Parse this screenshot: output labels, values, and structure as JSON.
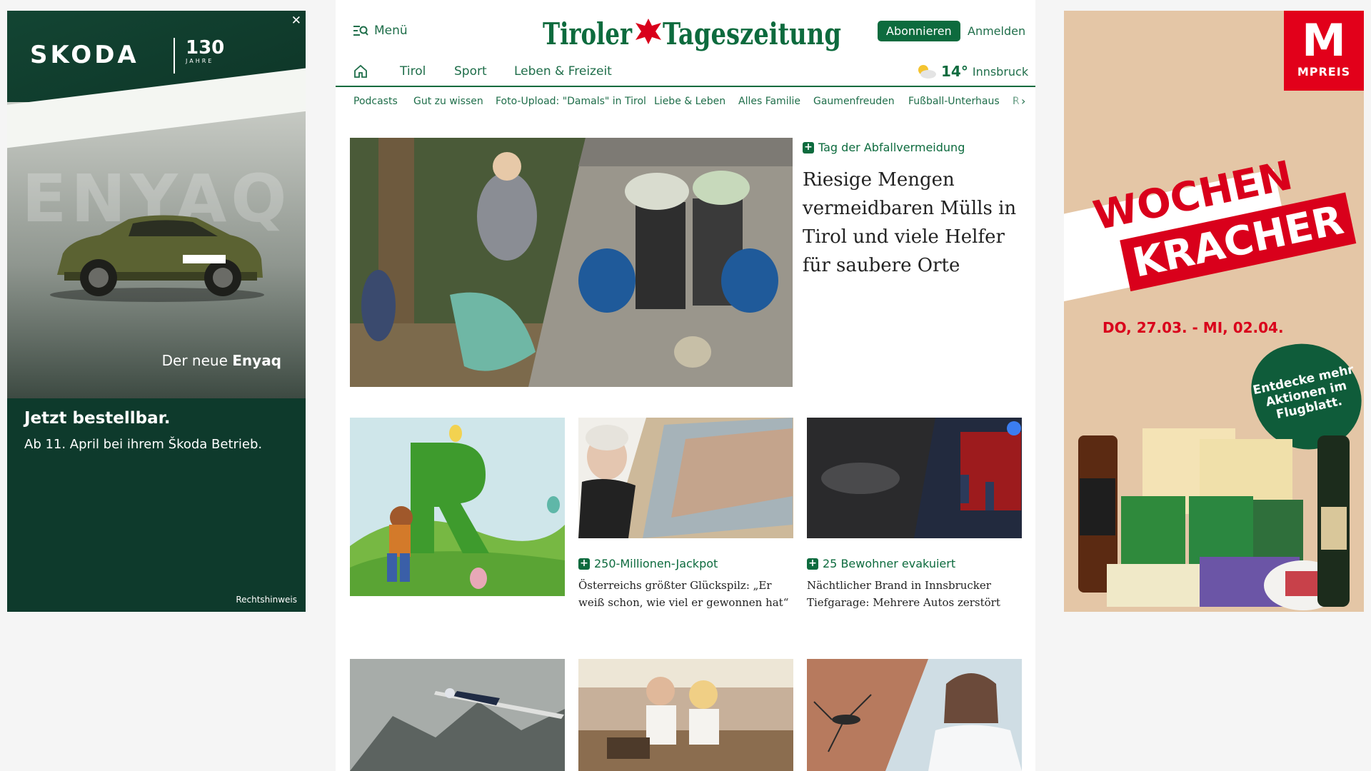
{
  "ad_left": {
    "close": "✕",
    "brand": "SKODA",
    "anniversary": "130",
    "anniversary_sub": "JAHRE",
    "bg_word": "ENYAQ",
    "tagline_prefix": "Der neue",
    "tagline_model": "Enyaq",
    "headline": "Jetzt bestellbar.",
    "sub": "Ab 11. April bei ihrem Škoda Betrieb.",
    "legal": "Rechtshinweis"
  },
  "ad_right": {
    "logo_letter": "M",
    "logo_text": "MPREIS",
    "title_line1": "WOCHEN",
    "title_line2": "KRACHER",
    "dates": "DO, 27.03. - MI, 02.04.",
    "badge": "Entdecke mehr Aktionen im Flugblatt.",
    "colors": {
      "red": "#e2001a",
      "green": "#0f5c3a"
    }
  },
  "header": {
    "menu_label": "Menü",
    "site_title": "Tiroler Tageszeitung",
    "subscribe": "Abonnieren",
    "login": "Anmelden"
  },
  "nav": {
    "items": [
      "Tirol",
      "Sport",
      "Leben & Freizeit"
    ],
    "weather_temp": "14°",
    "weather_city": "Innsbruck"
  },
  "subnav": {
    "items": [
      "Podcasts",
      "Gut zu wissen",
      "Foto-Upload: \"Damals\" in Tirol",
      "Liebe & Leben",
      "Alles Familie",
      "Gaumenfreuden",
      "Fußball-Unterhaus",
      "R"
    ]
  },
  "lead": {
    "kicker": "Tag der Abfallvermeidung",
    "title": "Riesige Mengen vermeidbaren Mülls in Tirol und viele Helfer für saubere Orte"
  },
  "cards": [
    {
      "kicker": "",
      "title": ""
    },
    {
      "kicker": "250-Millionen-Jackpot",
      "title": "Österreichs größter Glückspilz: „Er weiß schon, wie viel er gewonnen hat“"
    },
    {
      "kicker": "25 Bewohner evakuiert",
      "title": "Nächtlicher Brand in Innsbrucker Tiefgarage: Mehrere Autos zerstört"
    }
  ],
  "colors": {
    "brand_green": "#0d6b3e",
    "link_green": "#1f6e4a"
  }
}
